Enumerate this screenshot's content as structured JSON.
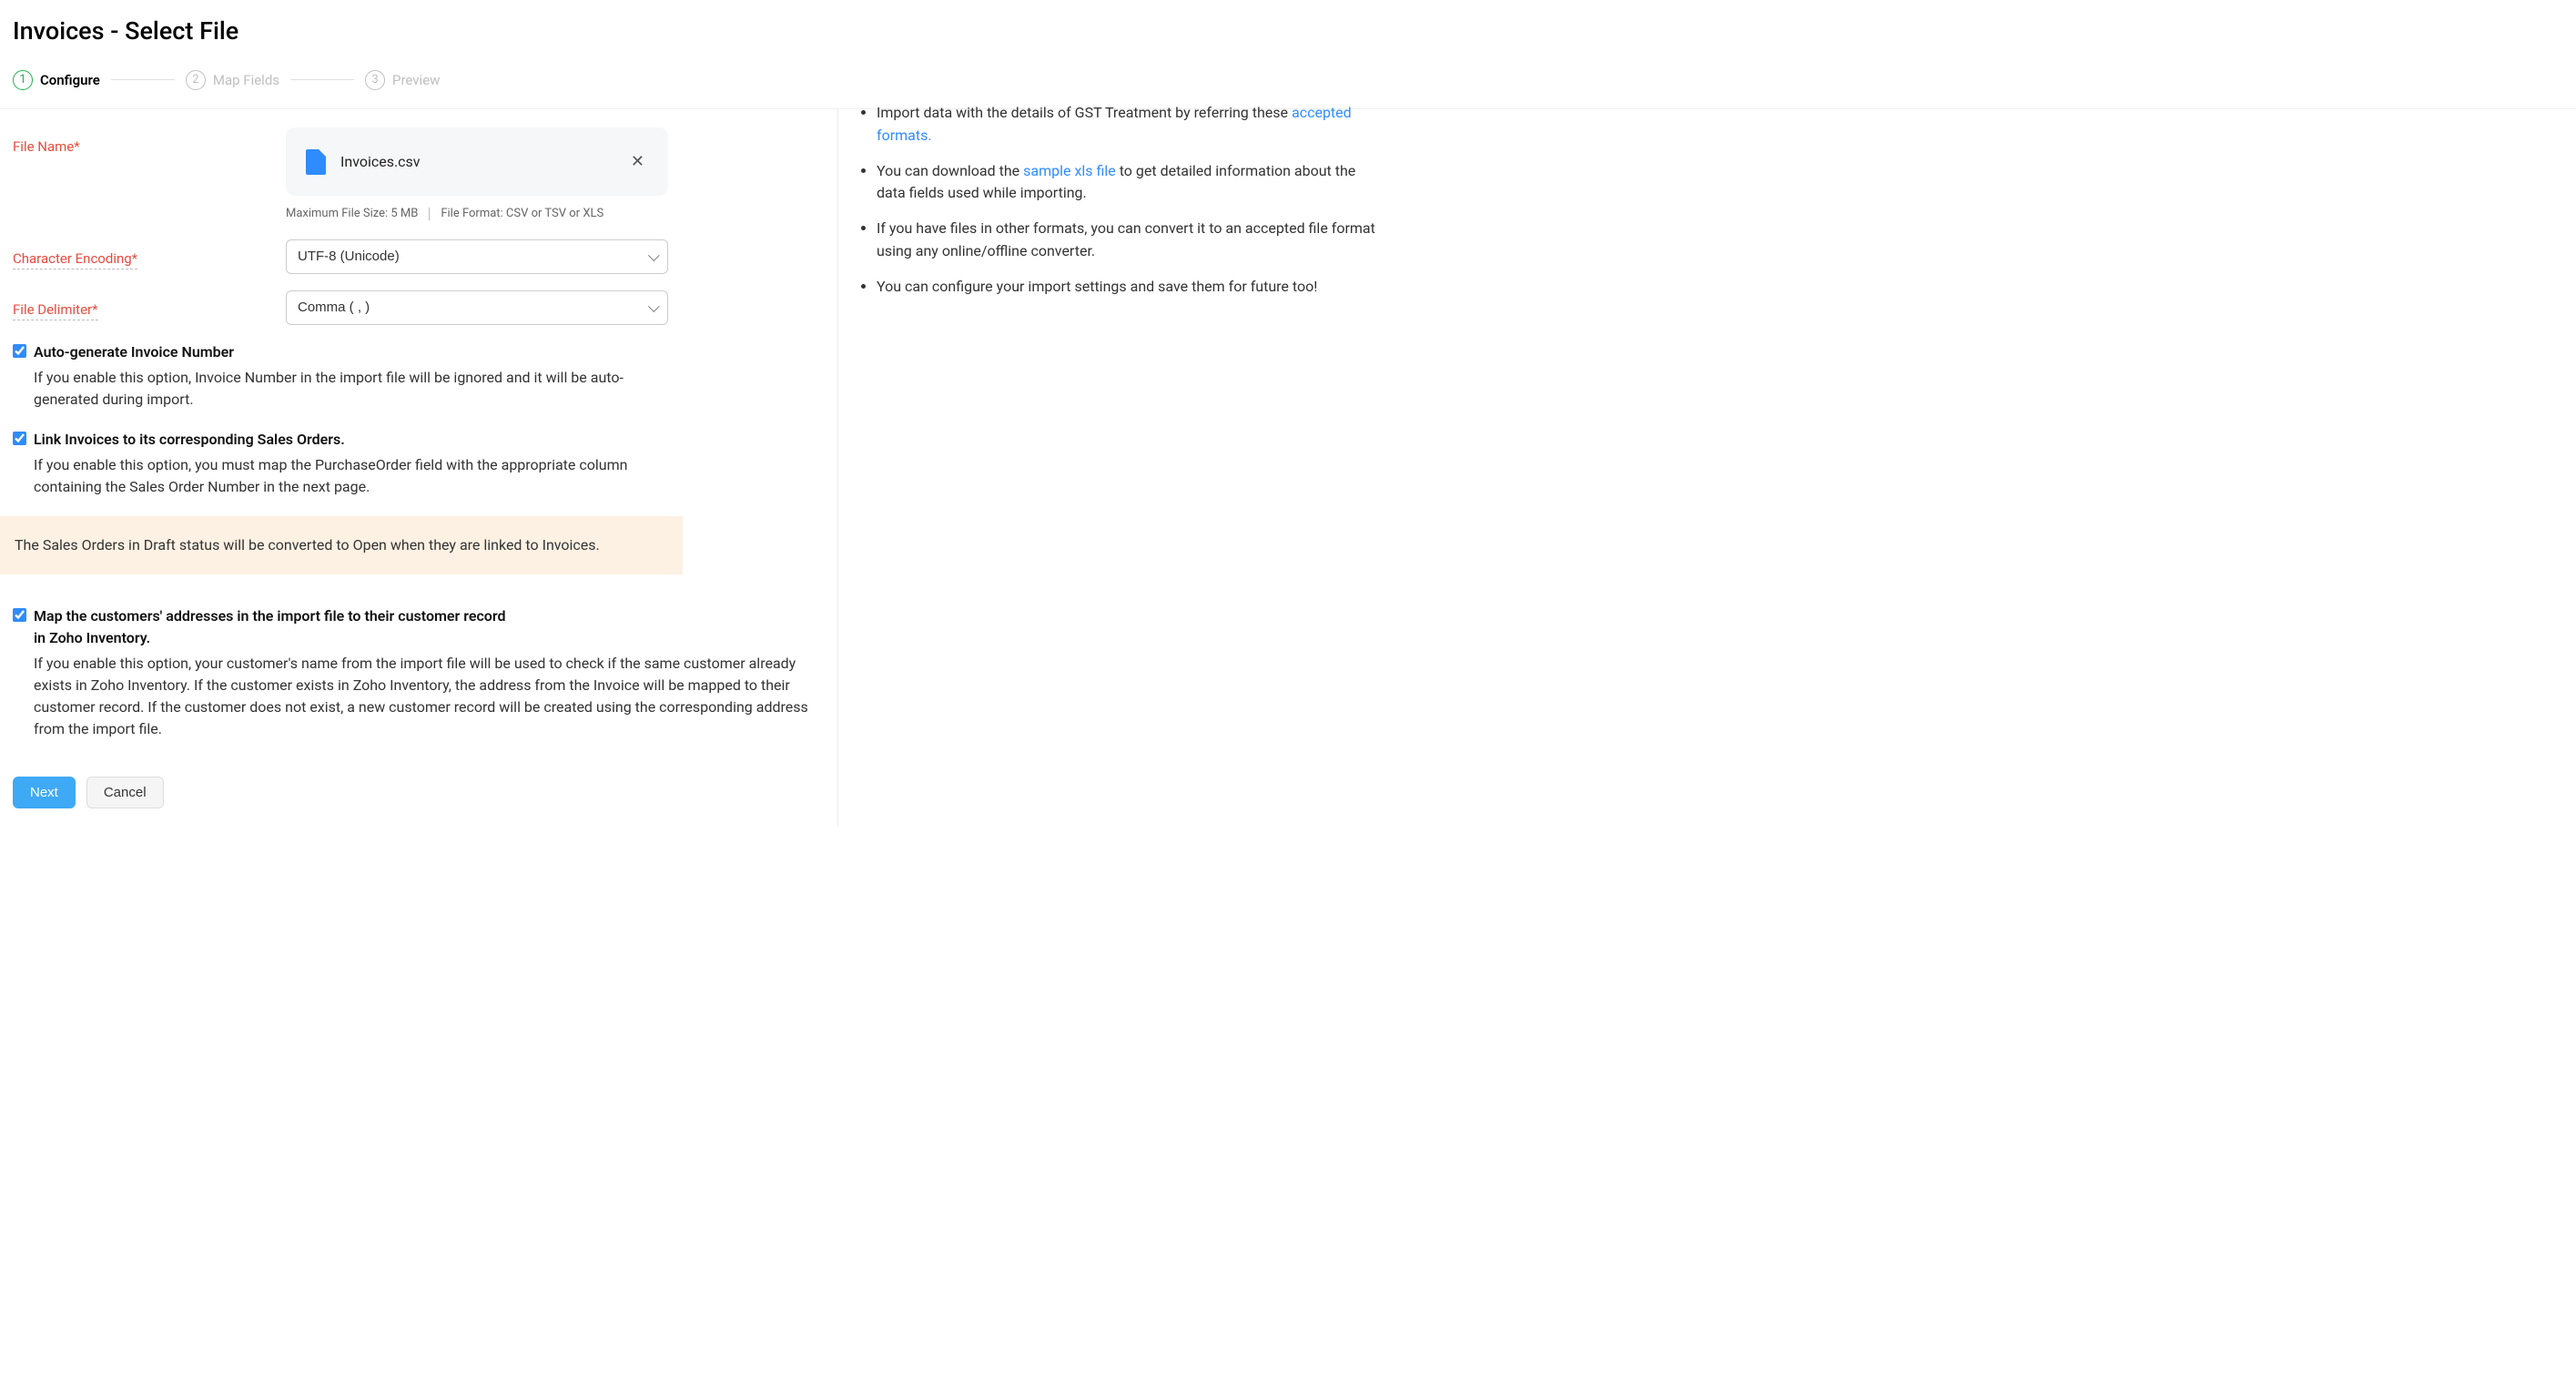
{
  "header": {
    "title": "Invoices - Select File"
  },
  "stepper": {
    "steps": [
      {
        "num": "1",
        "label": "Configure"
      },
      {
        "num": "2",
        "label": "Map Fields"
      },
      {
        "num": "3",
        "label": "Preview"
      }
    ]
  },
  "form": {
    "file_name_label": "File Name*",
    "file_name": "Invoices.csv",
    "max_size_hint": "Maximum File Size: 5 MB",
    "format_hint": "File Format: CSV or TSV or XLS",
    "encoding_label": "Character Encoding*",
    "encoding_value": "UTF-8 (Unicode)",
    "delimiter_label": "File Delimiter*",
    "delimiter_value": "Comma ( , )"
  },
  "options": {
    "auto_gen": {
      "label": "Auto-generate Invoice Number",
      "desc": "If you enable this option, Invoice Number in the import file will be ignored and it will be auto-generated during import."
    },
    "link_so": {
      "label": "Link Invoices to its corresponding Sales Orders.",
      "desc": "If you enable this option, you must map the PurchaseOrder field with the appropriate column containing the Sales Order Number in the next page."
    },
    "so_banner": "The Sales Orders in Draft status will be converted to Open when they are linked to Invoices.",
    "map_addr": {
      "label": "Map the customers' addresses in the import file to their customer record in Zoho Inventory.",
      "desc": "If you enable this option, your customer's name from the import file will be used to check if the same customer already exists in Zoho Inventory. If the customer exists in Zoho Inventory, the address from the Invoice will be mapped to their customer record. If the customer does not exist, a new customer record will be created using the corresponding address from the import file."
    }
  },
  "actions": {
    "next": "Next",
    "cancel": "Cancel"
  },
  "help": {
    "gst_partial": "Import data with the details of GST Treatment by referring these ",
    "gst_link": "accepted formats.",
    "xls_pre": "You can download the ",
    "xls_link": "sample xls file",
    "xls_post": " to get detailed information about the data fields used while importing.",
    "convert": "If you have files in other formats, you can convert it to an accepted file format using any online/offline converter.",
    "save": "You can configure your import settings and save them for future too!"
  }
}
